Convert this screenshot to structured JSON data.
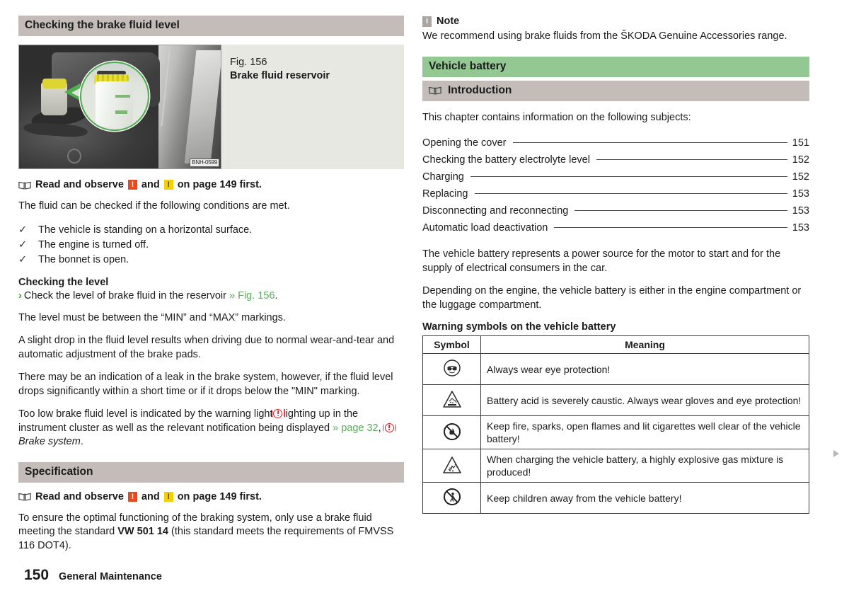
{
  "left": {
    "section_heading": "Checking the brake fluid level",
    "figure": {
      "number": "Fig. 156",
      "title": "Brake fluid reservoir",
      "image_code": "BNH-0599",
      "alt_name": "engine-bay-brake-fluid-reservoir-photo"
    },
    "read_observe": {
      "before": "Read and observe",
      "and": "and",
      "after": "on page 149 first."
    },
    "intro": "The fluid can be checked if the following conditions are met.",
    "conditions": [
      "The vehicle is standing on a horizontal surface.",
      "The engine is turned off.",
      "The bonnet is open."
    ],
    "checking_level_heading": "Checking the level",
    "checking_level_step": "Check the level of brake fluid in the reservoir",
    "checking_level_xref": "» Fig. 156",
    "para_min_max": "The level must be between the “MIN” and “MAX” markings.",
    "para_slight_drop": "A slight drop in the fluid level results when driving due to normal wear-and-tear and automatic adjustment of the brake pads.",
    "para_leak": "There may be an indication of a leak in the brake system, however, if the fluid level drops significantly within a short time or if it drops below the \"MIN\" marking.",
    "para_warning_a": "Too low brake fluid level is indicated by the warning light",
    "para_warning_b": "lighting up in the instrument cluster as well as the relevant notification being displayed",
    "warning_xref": "» page 32",
    "warning_ref_italic": "Brake system",
    "specification_heading": "Specification",
    "spec_text_a": "To ensure the optimal functioning of the braking system, only use a brake fluid meeting the standard",
    "spec_standard": "VW 501 14",
    "spec_text_b": "(this standard meets the requirements of FMVSS 116 DOT4)."
  },
  "right": {
    "note_label": "Note",
    "note_text": "We recommend using brake fluids from the ŠKODA Genuine Accessories range.",
    "chapter_heading": "Vehicle battery",
    "introduction_heading": "Introduction",
    "intro_line": "This chapter contains information on the following subjects:",
    "toc": [
      {
        "label": "Opening the cover",
        "page": "151"
      },
      {
        "label": "Checking the battery electrolyte level",
        "page": "152"
      },
      {
        "label": "Charging",
        "page": "152"
      },
      {
        "label": "Replacing",
        "page": "153"
      },
      {
        "label": "Disconnecting and reconnecting",
        "page": "153"
      },
      {
        "label": "Automatic load deactivation",
        "page": "153"
      }
    ],
    "para_power_source": "The vehicle battery represents a power source for the motor to start and for the supply of electrical consumers in the car.",
    "para_location": "Depending on the engine, the vehicle battery is either in the engine compartment or the luggage compartment.",
    "table_title": "Warning symbols on the vehicle battery",
    "table_headers": {
      "symbol": "Symbol",
      "meaning": "Meaning"
    },
    "table_rows": [
      {
        "symbol_name": "eye-protection-icon",
        "meaning": "Always wear eye protection!"
      },
      {
        "symbol_name": "caustic-acid-warning-icon",
        "meaning": "Battery acid is severely caustic. Always wear gloves and eye protection!"
      },
      {
        "symbol_name": "no-fire-icon",
        "meaning": "Keep fire, sparks, open flames and lit cigarettes well clear of the vehicle battery!"
      },
      {
        "symbol_name": "explosive-gas-warning-icon",
        "meaning": "When charging the vehicle battery, a highly explosive gas mixture is produced!"
      },
      {
        "symbol_name": "no-children-icon",
        "meaning": "Keep children away from the vehicle battery!"
      }
    ]
  },
  "footer": {
    "page_number": "150",
    "chapter_title": "General Maintenance"
  },
  "colors": {
    "heading_bar": "#c3bcb8",
    "chapter_bar": "#93c892",
    "figure_caption_bg": "#e8e8e3",
    "xref_green": "#5aa95a",
    "warning_red": "#e8491e",
    "warning_yellow": "#f5d000",
    "brake_light_red": "#d8232a"
  }
}
